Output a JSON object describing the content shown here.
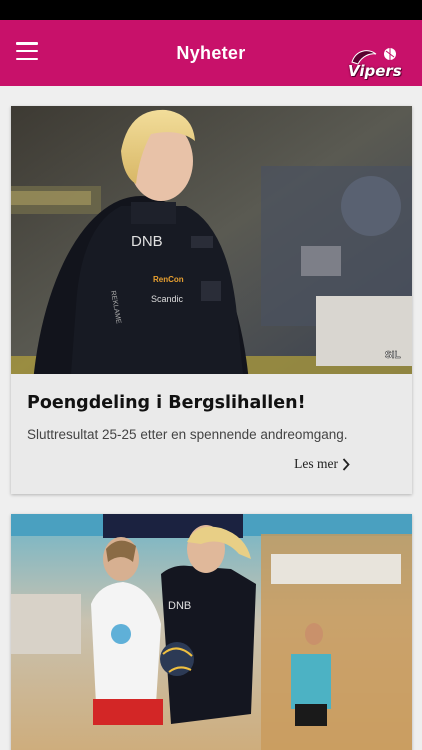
{
  "app_bar": {
    "title": "Nyheter",
    "logo_text": "Vipers",
    "menu_icon": "hamburger-menu-icon"
  },
  "colors": {
    "accent": "#c8116a",
    "status_bar": "#000000",
    "background": "#efefef",
    "card_body": "#eaeaea"
  },
  "articles": [
    {
      "title": "Poengdeling i Bergslihallen!",
      "summary": "Sluttresultat 25-25 etter en spennende andreomgang.",
      "read_more": "Les mer",
      "image": "coach-photo",
      "image_texts": {
        "sponsor_main": "DNB",
        "sponsor_2": "RenCon",
        "sponsor_3": "Scandic",
        "sleeve": "REKLAME",
        "watermark": "SIL"
      }
    },
    {
      "title": "",
      "summary": "",
      "read_more": "",
      "image": "handball-action-photo",
      "image_texts": {
        "sponsor_main": "DNB"
      }
    }
  ]
}
